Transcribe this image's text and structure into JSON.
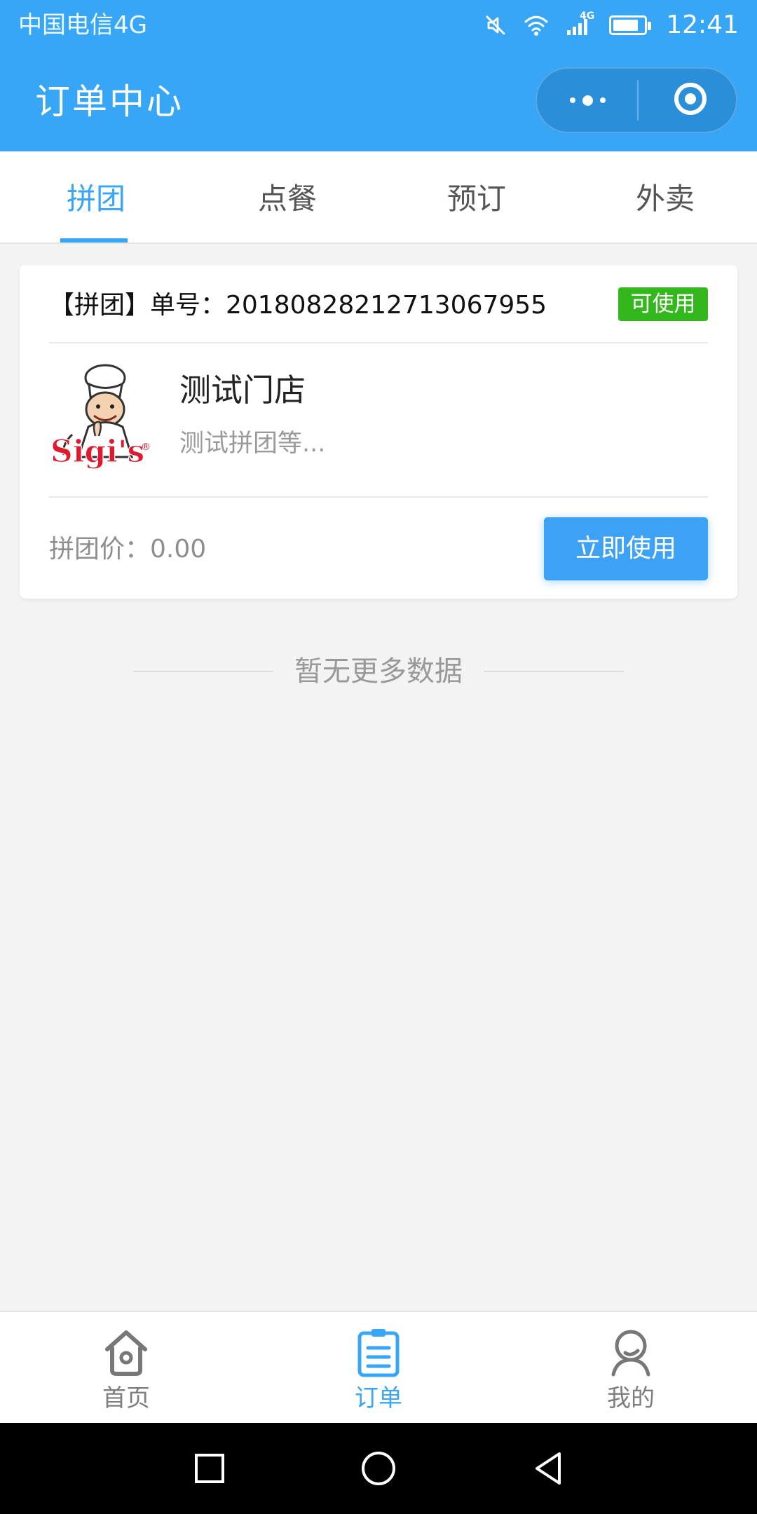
{
  "status_bar": {
    "carrier": "中国电信4G",
    "network": "4G",
    "time": "12:41",
    "battery_level": 0.82,
    "icons": [
      "mute-icon",
      "wifi-icon",
      "signal-icon",
      "battery-icon"
    ]
  },
  "header": {
    "title": "订单中心",
    "more_icon": "more-dots-icon",
    "close_icon": "target-icon",
    "background_color": "#37a6f6"
  },
  "tabs": [
    {
      "label": "拼团",
      "active": true
    },
    {
      "label": "点餐",
      "active": false
    },
    {
      "label": "预订",
      "active": false
    },
    {
      "label": "外卖",
      "active": false
    }
  ],
  "order": {
    "number_label": "【拼团】单号：20180828212713067955",
    "status": "可使用",
    "store_logo_text": "Sigi's",
    "store_logo_mark": "®",
    "store_name": "测试门店",
    "description": "测试拼团等...",
    "price_label": "拼团价：0.00",
    "action_label": "立即使用",
    "status_color": "#34b71d",
    "action_color": "#3da2f6"
  },
  "empty_state": {
    "text": "暂无更多数据"
  },
  "bottom_nav": [
    {
      "label": "首页",
      "icon": "home-icon",
      "active": false
    },
    {
      "label": "订单",
      "icon": "order-list-icon",
      "active": true
    },
    {
      "label": "我的",
      "icon": "profile-icon",
      "active": false
    }
  ],
  "system_nav": {
    "icons": [
      "recent-apps-icon",
      "home-circle-icon",
      "back-triangle-icon"
    ]
  }
}
